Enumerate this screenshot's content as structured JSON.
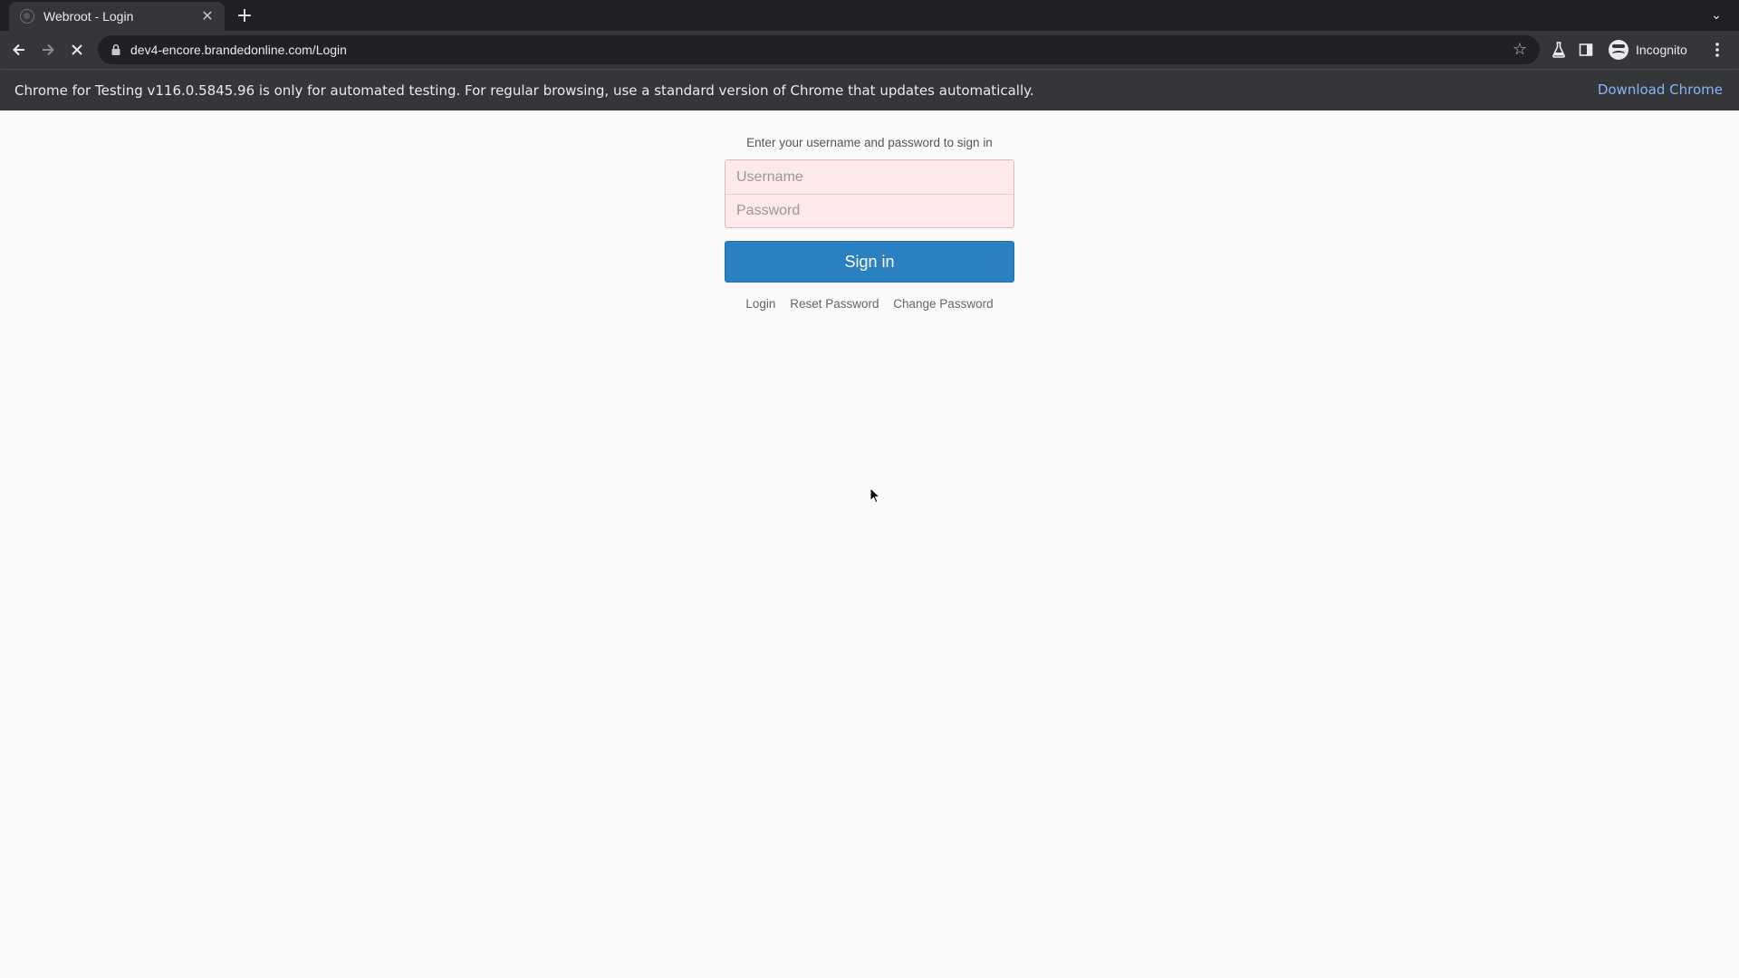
{
  "browser": {
    "tab": {
      "title": "Webroot - Login"
    },
    "address_bar": {
      "url": "dev4-encore.brandedonline.com/Login"
    },
    "profile": {
      "label": "Incognito"
    }
  },
  "infobar": {
    "message": "Chrome for Testing v116.0.5845.96 is only for automated testing. For regular browsing, use a standard version of Chrome that updates automatically.",
    "action_label": "Download Chrome"
  },
  "login": {
    "hint": "Enter your username and password to sign in",
    "username_placeholder": "Username",
    "password_placeholder": "Password",
    "signin_label": "Sign in",
    "links": [
      "Login",
      "Reset Password",
      "Change Password"
    ]
  },
  "colors": {
    "accent": "#2a80c0",
    "input_error_bg": "#fde9e9",
    "link": "#8ab4f8"
  }
}
